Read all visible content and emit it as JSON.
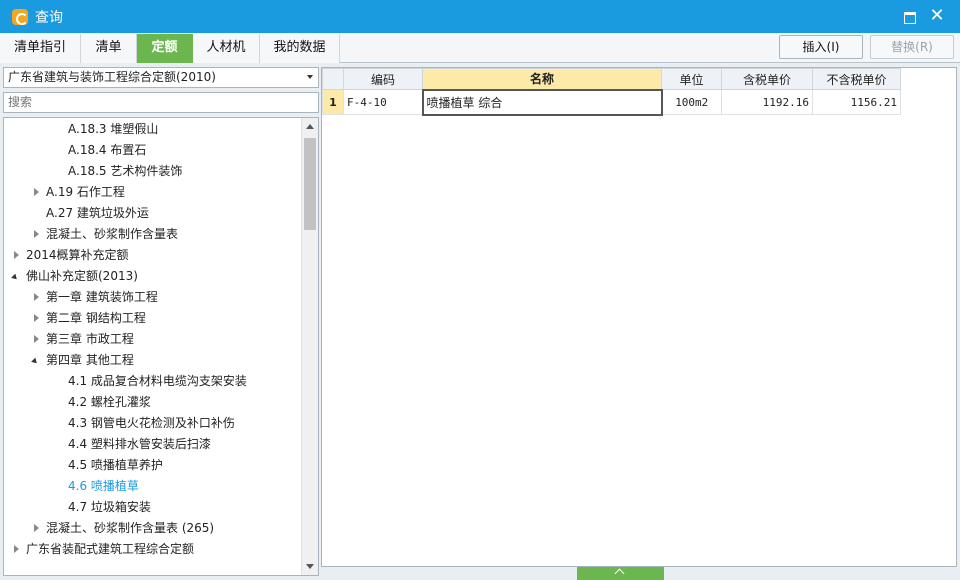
{
  "window": {
    "title": "查询"
  },
  "tabs": [
    "清单指引",
    "清单",
    "定额",
    "人材机",
    "我的数据"
  ],
  "active_tab": "定额",
  "toolbar": {
    "insert_label": "插入(I)",
    "replace_label": "替换(R)"
  },
  "left": {
    "quota_library": "广东省建筑与装饰工程综合定额(2010)",
    "search_placeholder": "搜索",
    "tree": [
      {
        "label": "A.18.3 堆塑假山",
        "level": 3,
        "toggle": "none"
      },
      {
        "label": "A.18.4 布置石",
        "level": 3,
        "toggle": "none"
      },
      {
        "label": "A.18.5 艺术构件装饰",
        "level": 3,
        "toggle": "none"
      },
      {
        "label": "A.19 石作工程",
        "level": 2,
        "toggle": "collapsed"
      },
      {
        "label": "A.27 建筑垃圾外运",
        "level": 2,
        "toggle": "none"
      },
      {
        "label": "混凝土、砂浆制作含量表",
        "level": 2,
        "toggle": "collapsed"
      },
      {
        "label": "2014概算补充定额",
        "level": 1,
        "toggle": "collapsed"
      },
      {
        "label": "佛山补充定额(2013)",
        "level": 1,
        "toggle": "expanded"
      },
      {
        "label": "第一章 建筑装饰工程",
        "level": 2,
        "toggle": "collapsed"
      },
      {
        "label": "第二章 钢结构工程",
        "level": 2,
        "toggle": "collapsed"
      },
      {
        "label": "第三章 市政工程",
        "level": 2,
        "toggle": "collapsed"
      },
      {
        "label": "第四章 其他工程",
        "level": 2,
        "toggle": "expanded"
      },
      {
        "label": "4.1 成品复合材料电缆沟支架安装",
        "level": 3,
        "toggle": "none"
      },
      {
        "label": "4.2 螺栓孔灌浆",
        "level": 3,
        "toggle": "none"
      },
      {
        "label": "4.3 钢管电火花检测及补口补伤",
        "level": 3,
        "toggle": "none"
      },
      {
        "label": "4.4 塑料排水管安装后扫漆",
        "level": 3,
        "toggle": "none"
      },
      {
        "label": "4.5 喷播植草养护",
        "level": 3,
        "toggle": "none"
      },
      {
        "label": "4.6 喷播植草",
        "level": 3,
        "toggle": "none",
        "selected": true
      },
      {
        "label": "4.7 垃圾箱安装",
        "level": 3,
        "toggle": "none"
      },
      {
        "label": "混凝土、砂浆制作含量表 (265)",
        "level": 2,
        "toggle": "collapsed"
      },
      {
        "label": "广东省装配式建筑工程综合定额",
        "level": 1,
        "toggle": "collapsed"
      }
    ]
  },
  "grid": {
    "columns": [
      "编码",
      "名称",
      "单位",
      "含税单价",
      "不含税单价"
    ],
    "rows": [
      {
        "index": "1",
        "code": "F-4-10",
        "name": "喷播植草 综合",
        "unit": "100m2",
        "tax_price": "1192.16",
        "notax_price": "1156.21"
      }
    ]
  }
}
